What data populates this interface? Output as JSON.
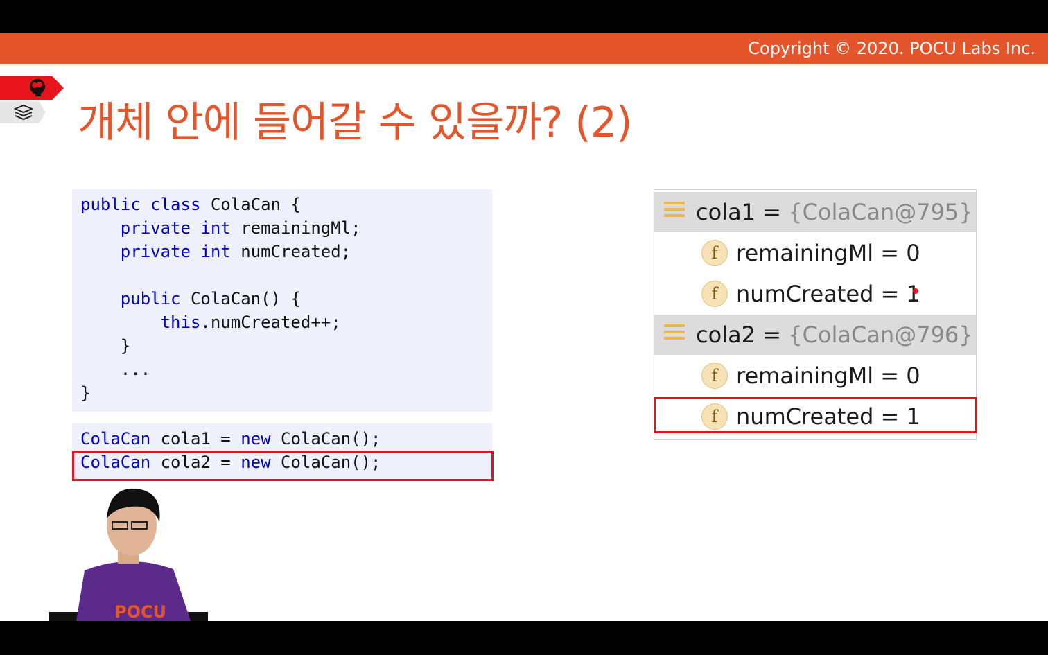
{
  "header": {
    "copyright": "Copyright © 2020. POCU Labs Inc."
  },
  "slide": {
    "title": "개체 안에 들어갈 수 있을까?  (2)"
  },
  "code_block_1": {
    "lines": [
      {
        "indent": "",
        "parts": [
          {
            "t": "public class",
            "kw": true
          },
          {
            "t": " ColaCan {",
            "kw": false
          }
        ]
      },
      {
        "indent": "    ",
        "parts": [
          {
            "t": "private int",
            "kw": true
          },
          {
            "t": " remainingMl;",
            "kw": false
          }
        ]
      },
      {
        "indent": "    ",
        "parts": [
          {
            "t": "private int",
            "kw": true
          },
          {
            "t": " numCreated;",
            "kw": false
          }
        ]
      },
      {
        "indent": "",
        "parts": []
      },
      {
        "indent": "    ",
        "parts": [
          {
            "t": "public",
            "kw": true
          },
          {
            "t": " ColaCan() {",
            "kw": false
          }
        ]
      },
      {
        "indent": "        ",
        "parts": [
          {
            "t": "this",
            "kw": true
          },
          {
            "t": ".numCreated++;",
            "kw": false
          }
        ]
      },
      {
        "indent": "    ",
        "parts": [
          {
            "t": "}",
            "kw": false
          }
        ]
      },
      {
        "indent": "    ",
        "parts": [
          {
            "t": "...",
            "kw": false
          }
        ]
      },
      {
        "indent": "",
        "parts": [
          {
            "t": "}",
            "kw": false
          }
        ]
      }
    ]
  },
  "code_block_2": {
    "lines": [
      {
        "indent": "",
        "parts": [
          {
            "t": "ColaCan",
            "kw": true
          },
          {
            "t": " cola1 = ",
            "kw": false
          },
          {
            "t": "new",
            "kw": true
          },
          {
            "t": " ColaCan();",
            "kw": false
          }
        ]
      },
      {
        "indent": "",
        "parts": [
          {
            "t": "ColaCan",
            "kw": true
          },
          {
            "t": " cola2 = ",
            "kw": false
          },
          {
            "t": "new",
            "kw": true
          },
          {
            "t": " ColaCan();",
            "kw": false
          }
        ]
      }
    ]
  },
  "debugger": {
    "rows": [
      {
        "kind": "object",
        "name": "cola1",
        "eq": " = ",
        "type": "{ColaCan@795}"
      },
      {
        "kind": "field",
        "icon": "f",
        "text": "remainingMl = 0"
      },
      {
        "kind": "field",
        "icon": "f",
        "text": "numCreated = 1"
      },
      {
        "kind": "object",
        "name": "cola2",
        "eq": " = ",
        "type": "{ColaCan@796}"
      },
      {
        "kind": "field",
        "icon": "f",
        "text": "remainingMl = 0"
      },
      {
        "kind": "field",
        "icon": "f",
        "text": "numCreated = 1"
      }
    ]
  },
  "colors": {
    "accent": "#e5552b",
    "keyword": "#0000c8",
    "highlight": "#e0161e",
    "code_bg": "#eef1fb"
  },
  "icons": [
    "brain-icon",
    "stack-icon",
    "object-icon",
    "field-icon"
  ],
  "presenter": {
    "shirt_text": "POCU"
  }
}
